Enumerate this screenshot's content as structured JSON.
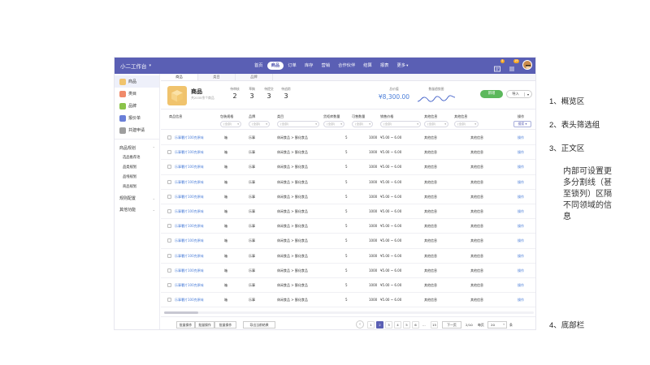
{
  "app": {
    "title": "小二工作台",
    "nav": [
      "首页",
      "商品",
      "订单",
      "库存",
      "营销",
      "合作伙伴",
      "结算",
      "报表",
      "更多"
    ],
    "active_nav": "商品",
    "notify_badges": [
      "5",
      "19"
    ]
  },
  "sidebar": {
    "items": [
      {
        "label": "商品",
        "color": "#f0c36d",
        "active": true
      },
      {
        "label": "类目",
        "color": "#f08a6a",
        "active": false
      },
      {
        "label": "品牌",
        "color": "#8bc34a",
        "active": false
      },
      {
        "label": "报价单",
        "color": "#6a7fd8",
        "active": false
      },
      {
        "label": "共建申请",
        "color": "#9e9e9e",
        "active": false
      }
    ],
    "group1": {
      "label": "商品规划",
      "subs": [
        "选品推荐池",
        "品类规划",
        "品线规划",
        "商品规划"
      ]
    },
    "group2": {
      "label": "规则配置"
    },
    "group3": {
      "label": "其他功能"
    }
  },
  "tabs": [
    "商品",
    "类目",
    "品牌"
  ],
  "overview": {
    "title": "商品",
    "subtitle": "共2035余个商品",
    "stats": [
      {
        "label": "待审核",
        "value": "2"
      },
      {
        "label": "草稿",
        "value": "3"
      },
      {
        "label": "待提交",
        "value": "3"
      },
      {
        "label": "待追踪",
        "value": "3"
      }
    ],
    "money_label": "总价值",
    "money_value": "¥8,300.00",
    "trend_label": "数量趋势图",
    "new_label": "新增",
    "import_label": "导入"
  },
  "table": {
    "columns": [
      "商品信息",
      "包装规格",
      "品牌",
      "类目",
      "货柜库数量",
      "可售数量",
      "销售价格",
      "其他信息",
      "其他信息",
      "操作"
    ],
    "filter_placeholder": "(全部)",
    "search_label": "搜索",
    "row_template": {
      "name": "乐事薯片100克原味",
      "spec": "箱",
      "brand": "乐事",
      "category": "休闲食品 > 膨化食品",
      "stock": "5",
      "sellable": "1000",
      "price": "¥5.00 ~ 6.00",
      "other1": "其他信息",
      "other2": "其他信息",
      "action": "操作"
    },
    "row_count": 12
  },
  "footer": {
    "batch_buttons": [
      "批量操作",
      "批量操作",
      "批量操作",
      "导出当前结果"
    ],
    "pages": [
      "1",
      "2",
      "3",
      "4",
      "5",
      "6"
    ],
    "current_page": "2",
    "ellipsis": "...",
    "last_page": "15",
    "next_label": "下一页",
    "page_info": "2/10",
    "page_size_label": "每页",
    "page_size": "20",
    "page_unit": "条"
  },
  "annotations": {
    "a1": "1、概览区",
    "a2": "2、表头筛选组",
    "a3": "3、正文区",
    "desc": "内部可设置更多分割线（甚至锁列）区隔不同领域的信息",
    "a4": "4、底部栏"
  }
}
